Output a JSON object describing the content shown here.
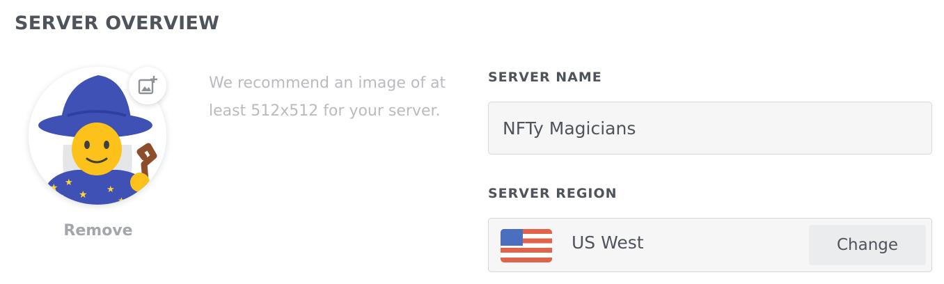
{
  "header": {
    "title": "SERVER OVERVIEW"
  },
  "icon": {
    "avatar": "mage-emoji-icon",
    "upload": "add-image-icon",
    "flag": "us-flag-icon"
  },
  "icon_upload": {
    "remove_label": "Remove",
    "recommendation": "We recommend an image of at least 512x512 for your server."
  },
  "server_name": {
    "label": "SERVER NAME",
    "value": "NFTy Magicians"
  },
  "server_region": {
    "label": "SERVER REGION",
    "region": "US West",
    "change_label": "Change"
  },
  "colors": {
    "heading": "#4f545c",
    "muted": "#b9bbbe",
    "input_bg": "#f6f6f7",
    "button_bg": "#ebecee"
  }
}
